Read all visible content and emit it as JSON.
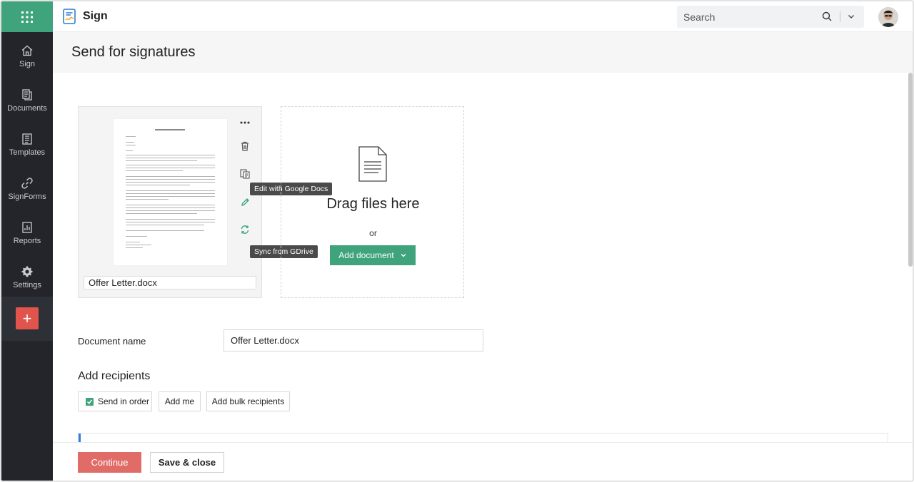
{
  "app": {
    "name": "Sign",
    "accent_color": "#3fa37c",
    "sidebar_color": "#23252b"
  },
  "search": {
    "placeholder": "Search"
  },
  "sidebar": {
    "items": [
      {
        "label": "Sign",
        "icon": "home-icon"
      },
      {
        "label": "Documents",
        "icon": "documents-icon"
      },
      {
        "label": "Templates",
        "icon": "templates-icon"
      },
      {
        "label": "SignForms",
        "icon": "link-icon"
      },
      {
        "label": "Reports",
        "icon": "reports-icon"
      },
      {
        "label": "Settings",
        "icon": "gear-icon"
      }
    ],
    "add_label": "+"
  },
  "page": {
    "title": "Send for signatures"
  },
  "upload": {
    "file_name": "Offer Letter.docx",
    "tooltip_edit": "Edit with Google Docs",
    "tooltip_sync": "Sync from GDrive",
    "drop_title": "Drag files here",
    "or_text": "or",
    "add_document_label": "Add document"
  },
  "form": {
    "document_name_label": "Document name",
    "document_name_value": "Offer Letter.docx",
    "recipients_heading": "Add recipients",
    "send_in_order_label": "Send in order",
    "send_in_order_checked": true,
    "add_me_label": "Add me",
    "add_bulk_label": "Add bulk recipients"
  },
  "footer": {
    "continue_label": "Continue",
    "save_close_label": "Save & close",
    "continue_color": "#e06b67"
  }
}
